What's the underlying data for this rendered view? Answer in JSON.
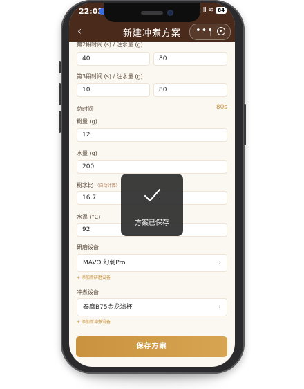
{
  "status_bar": {
    "time": "22:03",
    "signal": "ıll",
    "wifi": "≋",
    "battery": "84"
  },
  "nav": {
    "back": "‹",
    "title": "新建冲煮方案",
    "more": "•••"
  },
  "form": {
    "stage2_label": "第2段时间 (s) / 注水量 (g)",
    "stage2_time": "40",
    "stage2_water": "80",
    "stage3_label": "第3段时间 (s) / 注水量 (g)",
    "stage3_time": "10",
    "stage3_water": "80",
    "total_time_label": "总时间",
    "total_time_value": "80s",
    "coffee_label": "粉量 (g)",
    "coffee_value": "12",
    "water_label": "水量 (g)",
    "water_value": "200",
    "ratio_label": "粉水比",
    "ratio_hint": "（自动计算）",
    "ratio_value": "16.7",
    "temp_label": "水温 (°C)",
    "temp_value": "92",
    "grinder_label": "研磨设备",
    "grinder_value": "MAVO 幻刺Pro",
    "add_grinder": "+ 添加新研磨设备",
    "brewer_label": "冲煮设备",
    "brewer_value": "泰摩B75金龙滤杯",
    "add_brewer": "+ 添加新冲煮设备",
    "chevron": "›"
  },
  "save_button": "保存方案",
  "toast": {
    "text": "方案已保存"
  },
  "colors": {
    "header": "#4a2a1a",
    "accent": "#c9953d",
    "background": "#fbf7f1"
  }
}
